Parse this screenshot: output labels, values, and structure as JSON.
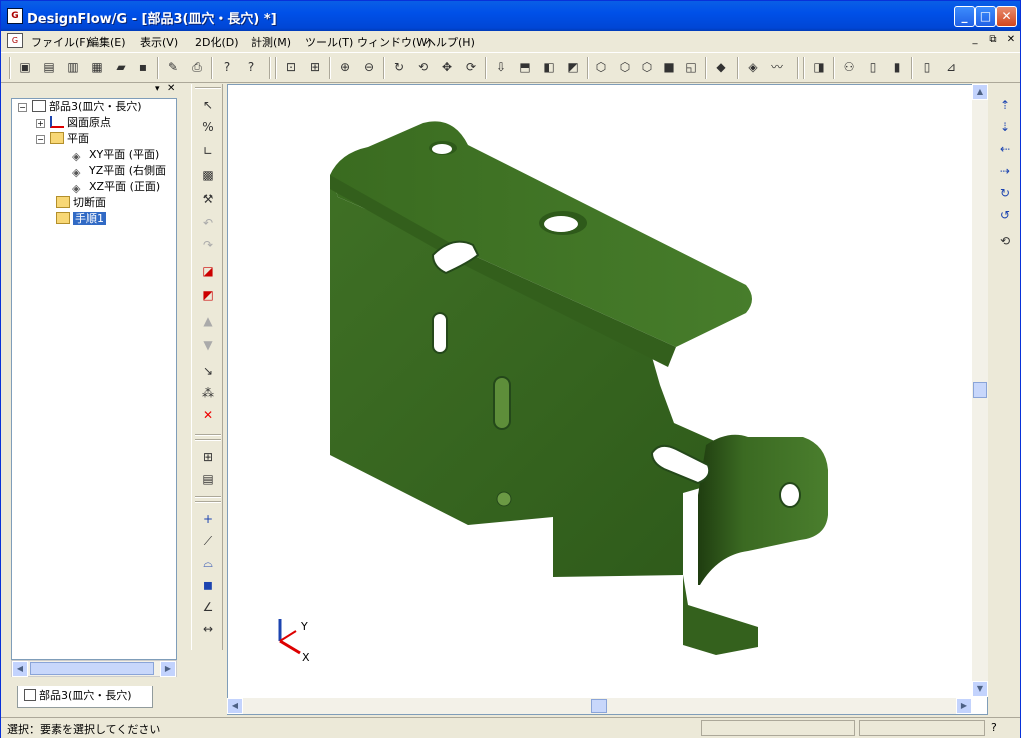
{
  "window": {
    "title": "DesignFlow/G - [部品3(皿穴・長穴) *]",
    "app_icon_glyph": "G"
  },
  "menu": {
    "items": [
      "ファイル(F)",
      "編集(E)",
      "表示(V)",
      "2D化(D)",
      "計測(M)",
      "ツール(T)",
      "ウィンドウ(W)",
      "ヘルプ(H)"
    ]
  },
  "tree": {
    "root": "部品3(皿穴・長穴)",
    "nodes": [
      {
        "label": "図面原点",
        "type": "origin"
      },
      {
        "label": "平面",
        "type": "folder"
      },
      {
        "label": "XY平面 (平面)",
        "type": "plane"
      },
      {
        "label": "YZ平面 (右側面",
        "type": "plane"
      },
      {
        "label": "XZ平面 (正面)",
        "type": "plane"
      },
      {
        "label": "切断面",
        "type": "folder"
      },
      {
        "label": "手順1",
        "type": "folder",
        "selected": true
      }
    ]
  },
  "tab": {
    "label": "部品3(皿穴・長穴)"
  },
  "axes": {
    "y": "Y",
    "x": "X"
  },
  "status": {
    "text": "選択：要素を選択してください",
    "help": "?"
  },
  "colors": {
    "part": "#3B6A22",
    "part_dark": "#2A4E18",
    "part_light": "#5E8E3A",
    "selection": "#316AC5"
  }
}
